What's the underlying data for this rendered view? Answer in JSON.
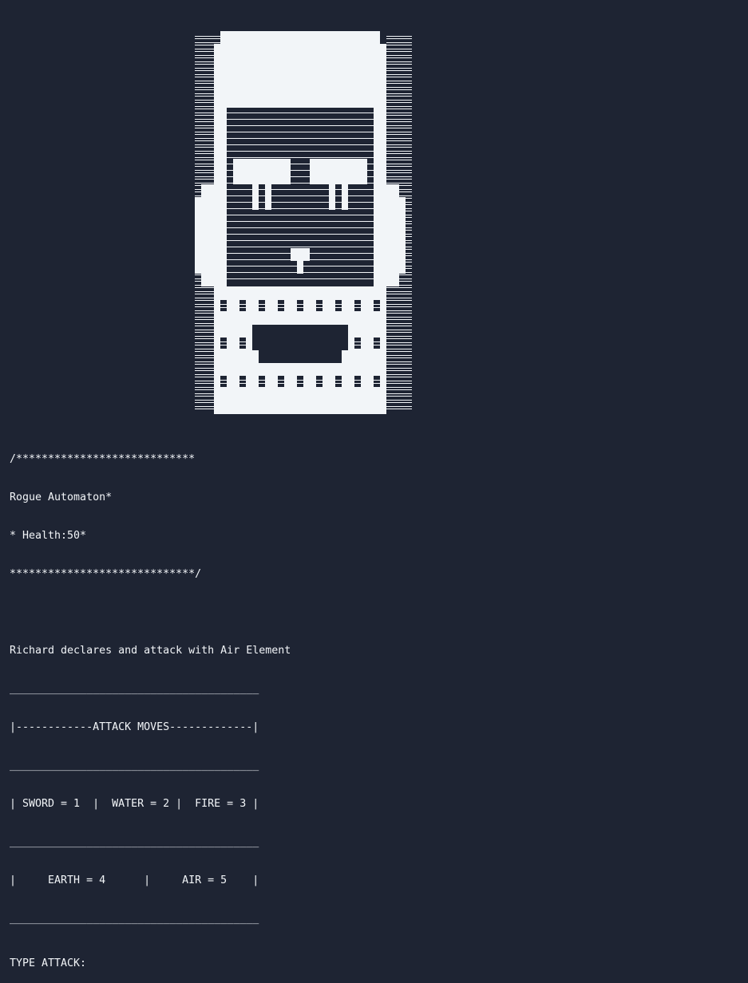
{
  "colors": {
    "background": "#1e2433",
    "foreground": "#f2f5f8"
  },
  "enemy": {
    "sprite_icon": "robot-ascii-art-icon",
    "header_top": "/****************************",
    "name_line": "Rogue Automaton*",
    "health_line": "* Health:50*",
    "header_bottom": "*****************************/"
  },
  "log": {
    "message": "Richard declares and attack with Air Element"
  },
  "menu": {
    "rule_top": "_______________________________________",
    "title_row": "|------------ATTACK MOVES-------------|",
    "rule_1": "_______________________________________",
    "row_1": "| SWORD = 1  |  WATER = 2 |  FIRE = 3 |",
    "rule_2": "_______________________________________",
    "row_2": "|     EARTH = 4      |     AIR = 5    |",
    "rule_bottom": "_______________________________________"
  },
  "prompt": {
    "label": "TYPE ATTACK:",
    "value": ""
  }
}
